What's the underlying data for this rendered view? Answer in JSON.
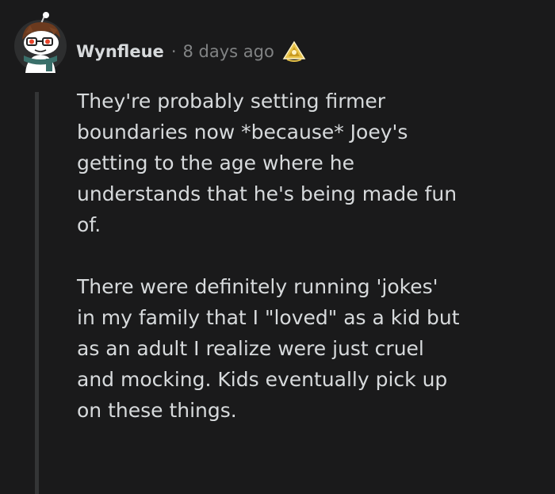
{
  "comment": {
    "author": "Wynfleue",
    "separator": "·",
    "timestamp": "8 days ago",
    "avatar_icon": "snoo-avatar-icon",
    "award_icon": "award-icon",
    "paragraphs": [
      "They're probably setting firmer\nboundaries now *because* Joey's\ngetting to the age where he\nunderstands that he's being made fun\nof.",
      "There were definitely running 'jokes'\nin my family that I \"loved\" as a kid but\nas an adult I realize were just cruel\nand mocking. Kids eventually pick up\non these things."
    ]
  },
  "colors": {
    "background": "#1a1a1b",
    "text": "#d7dadc",
    "meta": "#818384",
    "thread_line": "#343536",
    "avatar_bg": "#2a2a2b",
    "award_gold": "#e8c34a"
  }
}
